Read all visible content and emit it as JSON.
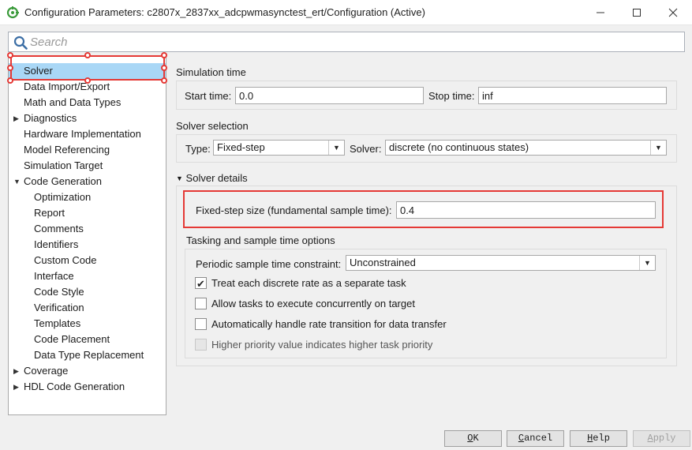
{
  "window": {
    "title": "Configuration Parameters: c2807x_2837xx_adcpwmasynctest_ert/Configuration (Active)"
  },
  "search": {
    "placeholder": "Search"
  },
  "tree": {
    "items": [
      {
        "label": "Solver",
        "selected": true
      },
      {
        "label": "Data Import/Export"
      },
      {
        "label": "Math and Data Types"
      },
      {
        "label": "Diagnostics",
        "arrow": "collapsed"
      },
      {
        "label": "Hardware Implementation"
      },
      {
        "label": "Model Referencing"
      },
      {
        "label": "Simulation Target"
      },
      {
        "label": "Code Generation",
        "arrow": "expanded"
      },
      {
        "label": "Optimization"
      },
      {
        "label": "Report"
      },
      {
        "label": "Comments"
      },
      {
        "label": "Identifiers"
      },
      {
        "label": "Custom Code"
      },
      {
        "label": "Interface"
      },
      {
        "label": "Code Style"
      },
      {
        "label": "Verification"
      },
      {
        "label": "Templates"
      },
      {
        "label": "Code Placement"
      },
      {
        "label": "Data Type Replacement"
      },
      {
        "label": "Coverage",
        "arrow": "collapsed"
      },
      {
        "label": "HDL Code Generation",
        "arrow": "collapsed"
      }
    ]
  },
  "simulation_time": {
    "title": "Simulation time",
    "start_label": "Start time:",
    "start_value": "0.0",
    "stop_label": "Stop time:",
    "stop_value": "inf"
  },
  "solver_selection": {
    "title": "Solver selection",
    "type_label": "Type:",
    "type_value": "Fixed-step",
    "solver_label": "Solver:",
    "solver_value": "discrete (no continuous states)"
  },
  "solver_details": {
    "title": "Solver details",
    "step_label": "Fixed-step size (fundamental sample time):",
    "step_value": "0.4"
  },
  "tasking": {
    "title": "Tasking and sample time options",
    "constraint_label": "Periodic sample time constraint:",
    "constraint_value": "Unconstrained",
    "checkboxes": [
      {
        "label": "Treat each discrete rate as a separate task",
        "checked": true
      },
      {
        "label": "Allow tasks to execute concurrently on target",
        "checked": false
      },
      {
        "label": "Automatically handle rate transition for data transfer",
        "checked": false
      },
      {
        "label": "Higher priority value indicates higher task priority",
        "checked": false,
        "disabled": true
      }
    ]
  },
  "buttons": {
    "ok_first": "O",
    "ok_rest": "K",
    "cancel_first": "C",
    "cancel_rest": "ancel",
    "help_first": "H",
    "help_rest": "elp",
    "apply_first": "A",
    "apply_rest": "pply"
  },
  "colors": {
    "selection": "#a9d7f6",
    "highlight": "#e53935"
  }
}
